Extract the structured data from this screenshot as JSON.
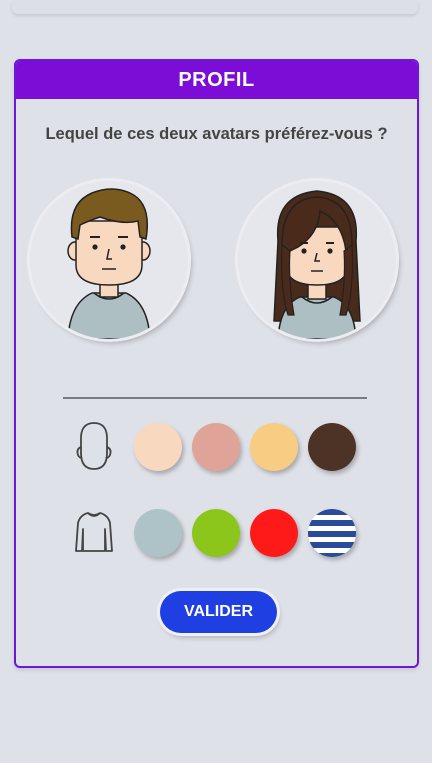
{
  "header": {
    "title": "PROFIL"
  },
  "question": "Lequel de ces deux avatars préférez-vous ?",
  "avatars": [
    {
      "name": "boy-avatar",
      "hair_color": "#7a5a1e",
      "shirt_color": "#aebfc4"
    },
    {
      "name": "girl-avatar",
      "hair_color": "#4a2a1a",
      "shirt_color": "#aebfc4"
    }
  ],
  "skin_colors": [
    "#f9d8c0",
    "#e0a398",
    "#f9cc84",
    "#4d3226"
  ],
  "shirt_colors": [
    "#aec3c7",
    "#8cc61b",
    "#ff1a1a",
    "striped-blue-white"
  ],
  "stripe_colors": {
    "dark": "#2a4a9a",
    "light": "#ffffff"
  },
  "accent_color": "#7b0dd7",
  "button_color": "#1f3fe3",
  "actions": {
    "validate_label": "VALIDER"
  },
  "icons": {
    "skin_row": "head-outline-icon",
    "shirt_row": "sweater-outline-icon"
  }
}
